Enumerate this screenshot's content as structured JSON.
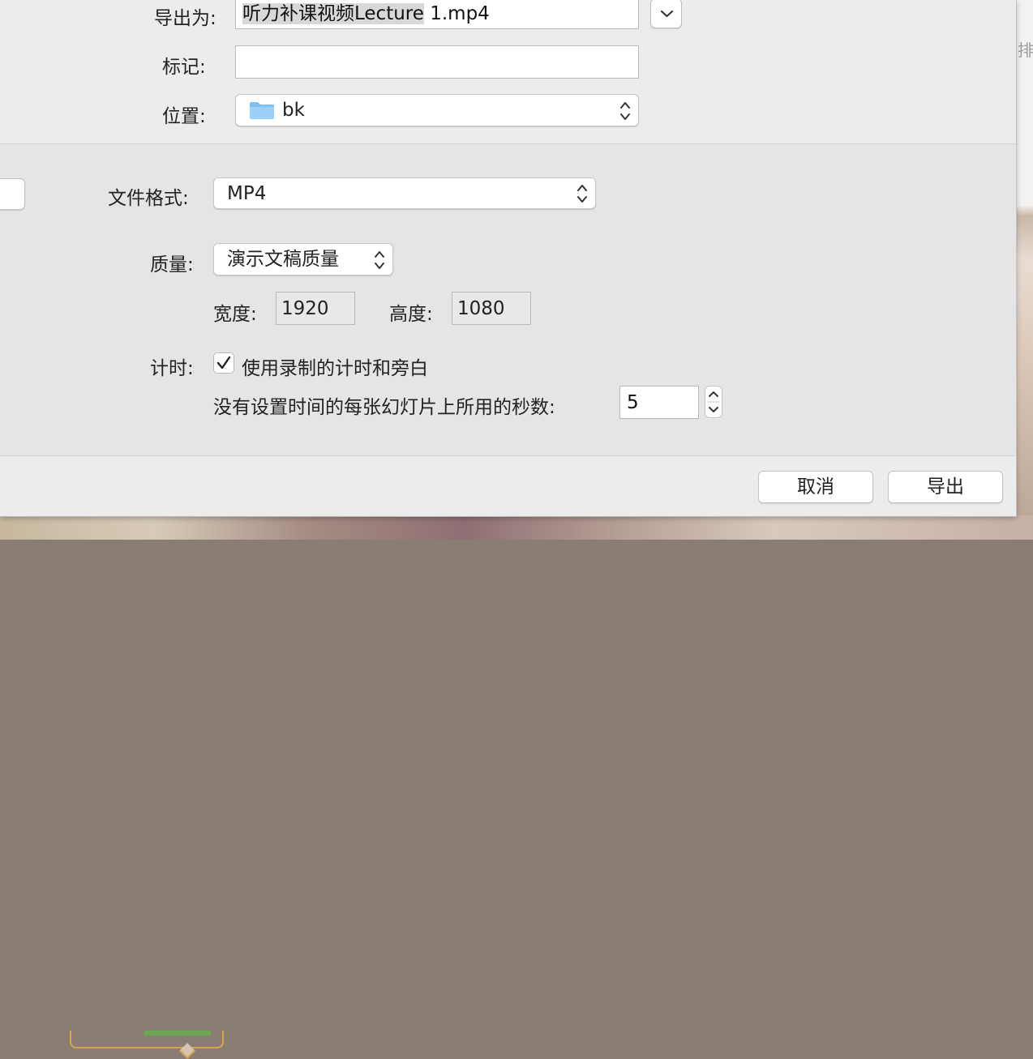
{
  "background": {
    "side_text": "排"
  },
  "save": {
    "export_as_label": "导出为:",
    "filename_selected": "听力补课视频Lecture",
    "filename_rest": " 1.mp4",
    "tags_label": "标记:",
    "tags_value": "",
    "location_label": "位置:",
    "location_value": "bk"
  },
  "format": {
    "file_format_label": "文件格式:",
    "file_format_value": "MP4",
    "quality_label": "质量:",
    "quality_value": "演示文稿质量",
    "width_label": "宽度:",
    "width_value": "1920",
    "height_label": "高度:",
    "height_value": "1080",
    "timing_label": "计时:",
    "timing_checkbox_label": "使用录制的计时和旁白",
    "timing_checked": true,
    "seconds_label": "没有设置时间的每张幻灯片上所用的秒数:",
    "seconds_value": "5"
  },
  "buttons": {
    "cancel_label": "取消",
    "export_label": "导出"
  }
}
